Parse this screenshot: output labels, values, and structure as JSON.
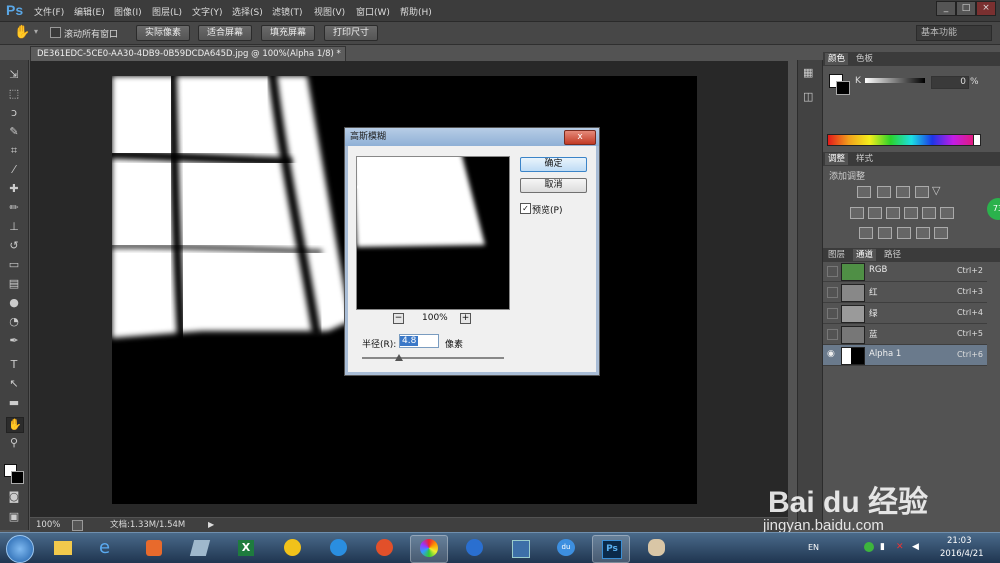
{
  "menubar": {
    "logo": "Ps",
    "items": [
      "文件(F)",
      "编辑(E)",
      "图像(I)",
      "图层(L)",
      "文字(Y)",
      "选择(S)",
      "滤镜(T)",
      "视图(V)",
      "窗口(W)",
      "帮助(H)"
    ]
  },
  "optbar": {
    "scroll_all_label": "滚动所有窗口",
    "buttons": [
      "实际像素",
      "适合屏幕",
      "填充屏幕",
      "打印尺寸"
    ],
    "workspace": "基本功能"
  },
  "document": {
    "tab_title": "DE361EDC-5CE0-AA30-4DB9-0B59DCDA645D.jpg @ 100%(Alpha 1/8) *",
    "tab_close": "×"
  },
  "status": {
    "zoom": "100%",
    "doc_info": "文档:1.33M/1.54M"
  },
  "dialog": {
    "title": "高斯模糊",
    "close": "x",
    "ok": "确定",
    "cancel": "取消",
    "preview_label": "预览(P)",
    "preview_checked": true,
    "zoom": "100%",
    "zoom_out": "−",
    "zoom_in": "+",
    "radius_label": "半径(R):",
    "radius_value": "4.8",
    "radius_unit": "像素"
  },
  "color_panel": {
    "tab_color": "颜色",
    "tab_swatches": "色板",
    "k_label": "K",
    "k_value": "0",
    "percent": "%"
  },
  "adjust_panel": {
    "tab_adjust": "调整",
    "tab_style": "样式",
    "add_label": "添加调整"
  },
  "channels_panel": {
    "tab_layers": "图层",
    "tab_channels": "通道",
    "tab_paths": "路径",
    "rows": [
      {
        "name": "RGB",
        "shortcut": "Ctrl+2"
      },
      {
        "name": "红",
        "shortcut": "Ctrl+3"
      },
      {
        "name": "绿",
        "shortcut": "Ctrl+4"
      },
      {
        "name": "蓝",
        "shortcut": "Ctrl+5"
      },
      {
        "name": "Alpha 1",
        "shortcut": "Ctrl+6"
      }
    ]
  },
  "side_badge": "73",
  "taskbar": {
    "lang": "EN",
    "time": "21:03",
    "date": "2016/4/21"
  },
  "watermark": {
    "brand": "Bai du 经验",
    "url": "jingyan.baidu.com"
  }
}
